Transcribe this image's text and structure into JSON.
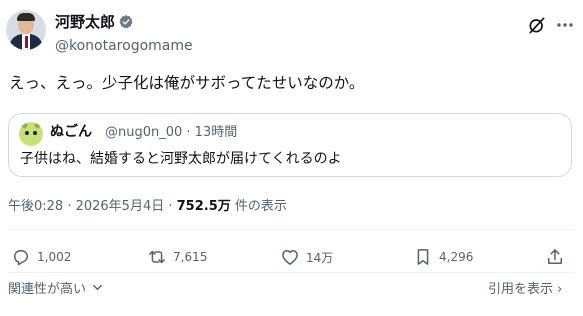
{
  "author": {
    "name": "河野太郎",
    "handle": "@konotarogomame",
    "verified": true
  },
  "tweet": {
    "text": "えっ、えっ。少子化は俺がサボってたせいなのか。"
  },
  "quote": {
    "name": "ぬごん",
    "handle_time": "@nug0n_00 · 13時間",
    "text": "子供はね、結婚すると河野太郎が届けてくれるのよ"
  },
  "meta": {
    "time": "午後0:28 · 2026年5月4日 · ",
    "views_count": "752.5万",
    "views_label": " 件の表示"
  },
  "actions": {
    "replies": "1,002",
    "retweets": "7,615",
    "likes": "14万",
    "bookmarks": "4,296"
  },
  "footer": {
    "sort_label": "関連性が高い",
    "quotes_label": "引用を表示 ›"
  },
  "colors": {
    "accent": "#1d9bf0",
    "muted": "#536471",
    "text": "#0f1419"
  },
  "icons": [
    "verified-badge-icon",
    "grok-icon",
    "more-icon",
    "reply-icon",
    "retweet-icon",
    "like-icon",
    "bookmark-icon",
    "share-icon",
    "chevron-down-icon"
  ]
}
